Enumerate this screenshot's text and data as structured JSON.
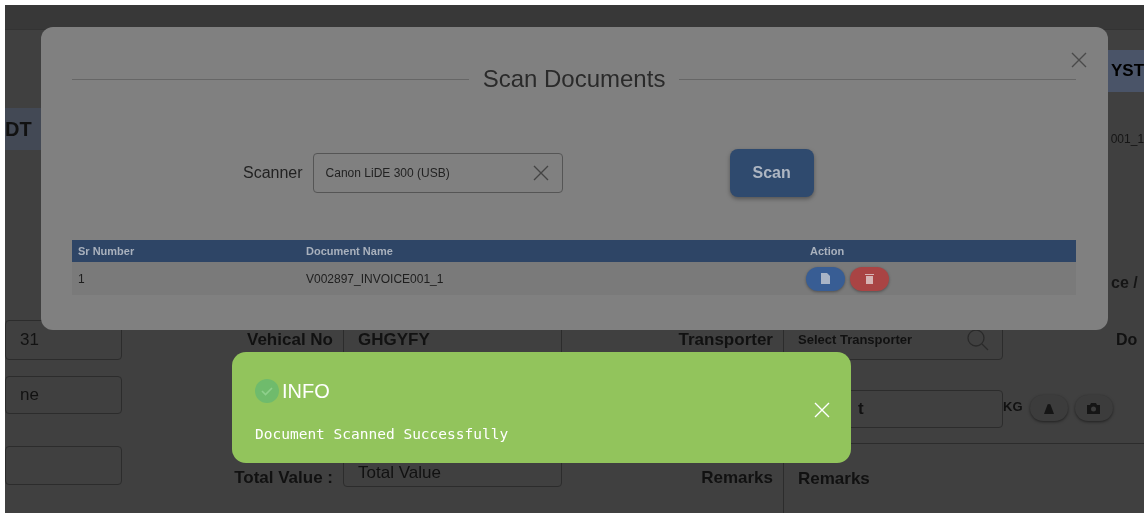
{
  "background": {
    "banner_text": "YST",
    "section_text": "DT",
    "file_text": "001_1",
    "column_text": "ce /",
    "row_1": {
      "field_value": "31",
      "vehicle_label": "Vehical No",
      "vehicle_value": "GHGYFY",
      "transporter_label": "Transporter",
      "transporter_placeholder": "Select Transporter",
      "next_label": "Do"
    },
    "row_2": {
      "field_placeholder": "ne",
      "weight_placeholder": "t",
      "unit": "KG"
    },
    "row_3": {
      "total_label": "Total Value :",
      "total_placeholder": "Total Value",
      "remarks_label": "Remarks",
      "remarks_placeholder": "Remarks"
    }
  },
  "modal": {
    "title": "Scan Documents",
    "scanner_label": "Scanner",
    "scanner_value": "Canon LiDE 300 (USB)",
    "scan_button": "Scan",
    "table": {
      "columns": [
        "Sr Number",
        "Document Name",
        "Action"
      ],
      "rows": [
        {
          "sr_number": "1",
          "document_name": "V002897_INVOICE001_1"
        }
      ]
    }
  },
  "toast": {
    "title": "INFO",
    "message": "Document Scanned Successfully"
  }
}
